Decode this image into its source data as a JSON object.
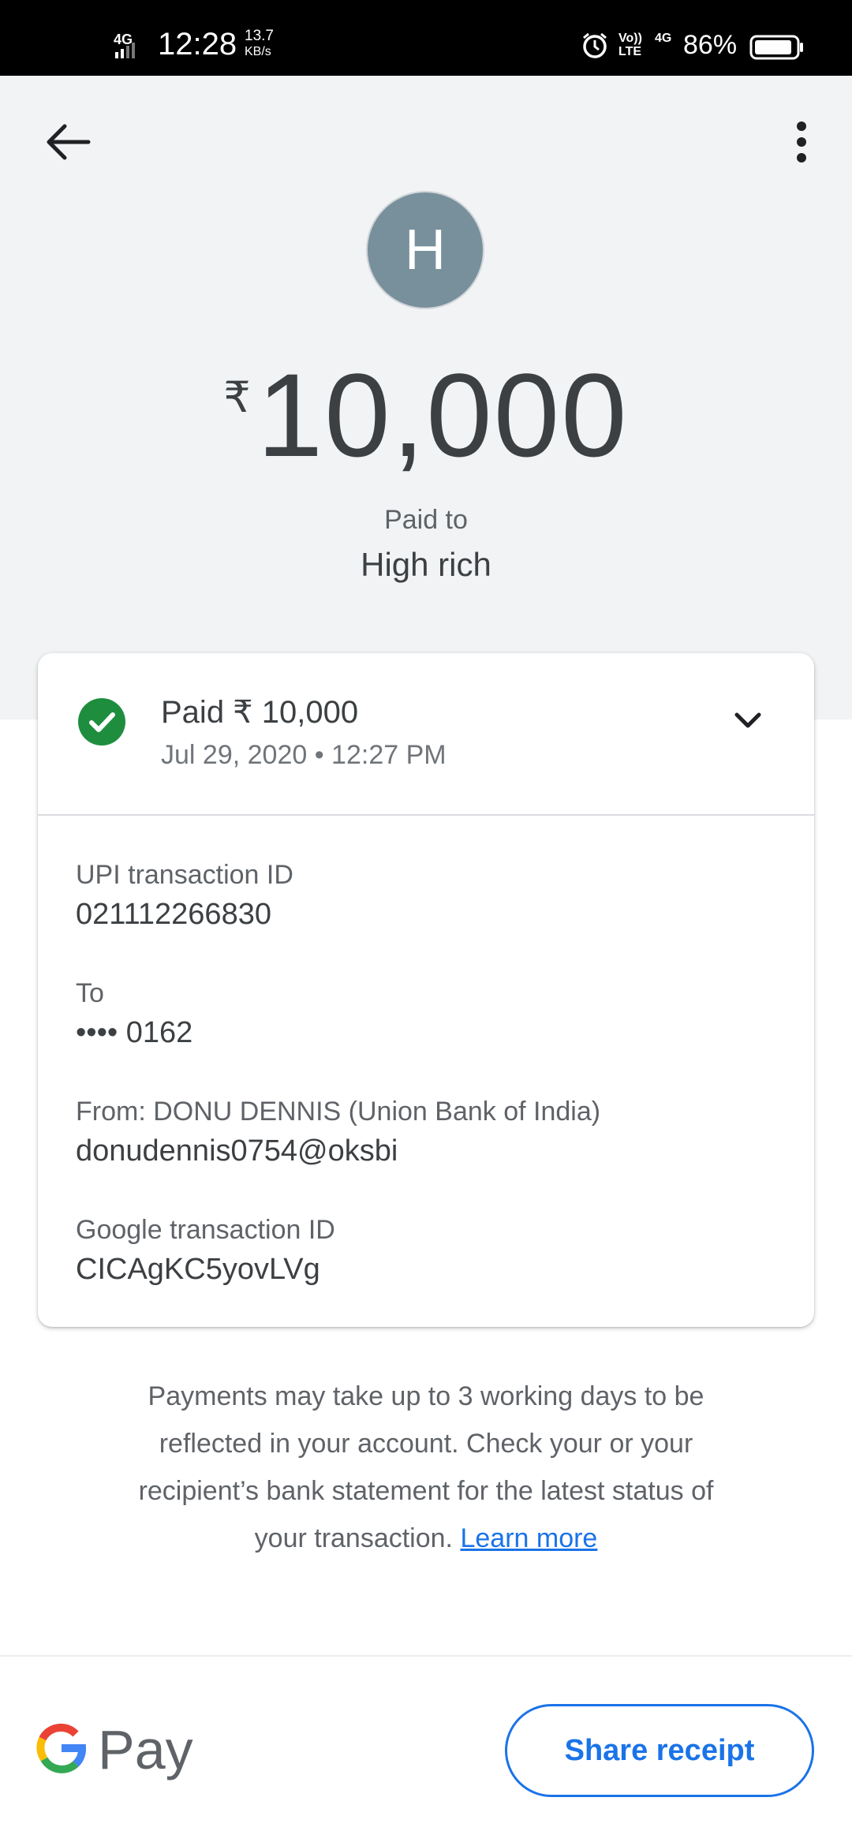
{
  "status_bar": {
    "network_left": "4G",
    "time": "12:28",
    "speed_value": "13.7",
    "speed_unit": "KB/s",
    "volte": "Vo)) LTE",
    "network_right": "4G",
    "battery": "86%"
  },
  "header": {
    "back_icon": "arrow-back-icon",
    "more_icon": "more-vert-icon"
  },
  "payee": {
    "avatar_letter": "H",
    "currency": "₹",
    "amount": "10,000",
    "paid_to_label": "Paid to",
    "name": "High rich"
  },
  "card": {
    "status_icon": "check-circle-icon",
    "title": "Paid ₹ 10,000",
    "datetime": "Jul 29, 2020 • 12:27 PM",
    "details": [
      {
        "label": "UPI transaction ID",
        "value": "021112266830"
      },
      {
        "label": "To",
        "value": "•••• 0162"
      },
      {
        "label": "From: DONU DENNIS (Union Bank of India)",
        "value": "donudennis0754@oksbi"
      },
      {
        "label": "Google transaction ID",
        "value": "CICAgKC5yovLVg"
      }
    ]
  },
  "note": {
    "text": "Payments may take up to 3 working days to be reflected in your account. Check your or your recipient’s bank statement for the latest status of your transaction.",
    "link": "Learn more"
  },
  "footer": {
    "logo_text": "Pay",
    "share_label": "Share receipt"
  },
  "colors": {
    "accent": "#1a73e8",
    "success": "#1e8e3e",
    "avatar": "#78909c",
    "header_bg": "#f1f3f4"
  }
}
